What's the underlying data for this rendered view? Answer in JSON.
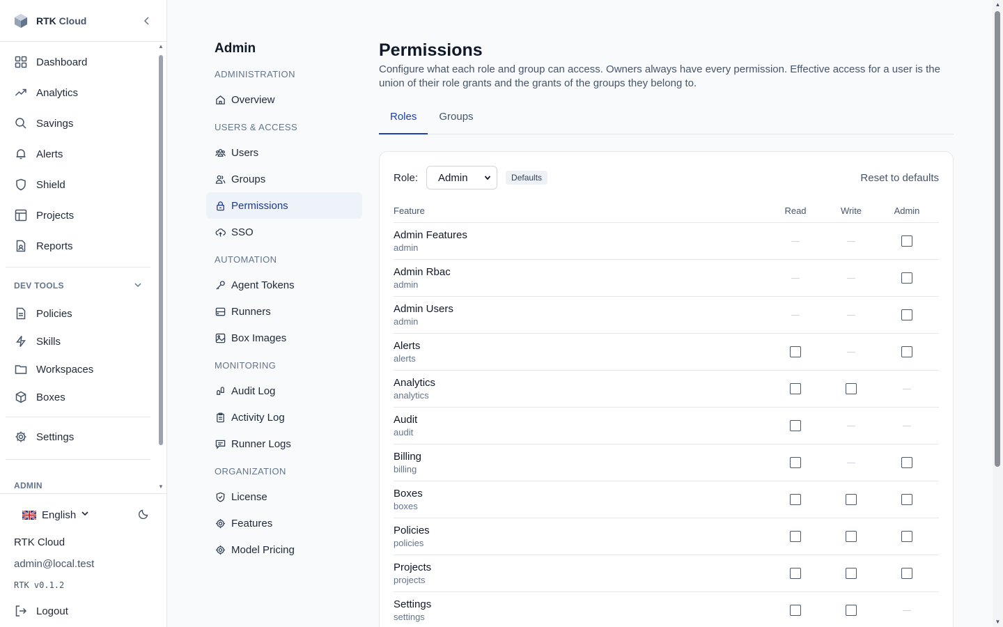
{
  "brand": {
    "name_part1": "RTK",
    "name_part2": "Cloud"
  },
  "sidebar": {
    "items": [
      {
        "label": "Dashboard",
        "icon": "dashboard-icon"
      },
      {
        "label": "Analytics",
        "icon": "trend-icon"
      },
      {
        "label": "Savings",
        "icon": "search-icon"
      },
      {
        "label": "Alerts",
        "icon": "bell-icon"
      },
      {
        "label": "Shield",
        "icon": "shield-icon"
      },
      {
        "label": "Projects",
        "icon": "table-icon"
      },
      {
        "label": "Reports",
        "icon": "report-icon"
      }
    ],
    "dev_tools_label": "DEV TOOLS",
    "dev_tools": [
      {
        "label": "Policies",
        "icon": "document-icon"
      },
      {
        "label": "Skills",
        "icon": "bolt-icon"
      },
      {
        "label": "Workspaces",
        "icon": "folder-icon"
      },
      {
        "label": "Boxes",
        "icon": "box-icon"
      }
    ],
    "settings_label": "Settings",
    "admin_label": "ADMIN"
  },
  "footer": {
    "language": "English",
    "org_name": "RTK Cloud",
    "email": "admin@local.test",
    "version": "RTK v0.1.2",
    "logout": "Logout"
  },
  "subnav": {
    "title": "Admin",
    "sections": {
      "administration": "ADMINISTRATION",
      "users_access": "USERS & ACCESS",
      "automation": "AUTOMATION",
      "monitoring": "MONITORING",
      "organization": "ORGANIZATION"
    },
    "overview": "Overview",
    "users": "Users",
    "groups": "Groups",
    "permissions": "Permissions",
    "sso": "SSO",
    "agent_tokens": "Agent Tokens",
    "runners": "Runners",
    "box_images": "Box Images",
    "audit_log": "Audit Log",
    "activity_log": "Activity Log",
    "runner_logs": "Runner Logs",
    "license": "License",
    "features": "Features",
    "model_pricing": "Model Pricing"
  },
  "main": {
    "title": "Permissions",
    "description": "Configure what each role and group can access. Owners always have every permission. Effective access for a user is the union of their role grants and the grants of the groups they belong to.",
    "tabs": [
      "Roles",
      "Groups"
    ],
    "role_label": "Role:",
    "role_value": "Admin",
    "badge": "Defaults",
    "reset": "Reset to defaults",
    "columns": {
      "feature": "Feature",
      "read": "Read",
      "write": "Write",
      "admin": "Admin"
    },
    "rows": [
      {
        "name": "Admin Features",
        "key": "admin",
        "read": "n/a",
        "write": "n/a",
        "admin": "off"
      },
      {
        "name": "Admin Rbac",
        "key": "admin",
        "read": "n/a",
        "write": "n/a",
        "admin": "off"
      },
      {
        "name": "Admin Users",
        "key": "admin",
        "read": "n/a",
        "write": "n/a",
        "admin": "off"
      },
      {
        "name": "Alerts",
        "key": "alerts",
        "read": "off",
        "write": "n/a",
        "admin": "off"
      },
      {
        "name": "Analytics",
        "key": "analytics",
        "read": "off",
        "write": "off",
        "admin": "n/a"
      },
      {
        "name": "Audit",
        "key": "audit",
        "read": "off",
        "write": "n/a",
        "admin": "n/a"
      },
      {
        "name": "Billing",
        "key": "billing",
        "read": "off",
        "write": "n/a",
        "admin": "off"
      },
      {
        "name": "Boxes",
        "key": "boxes",
        "read": "off",
        "write": "off",
        "admin": "off"
      },
      {
        "name": "Policies",
        "key": "policies",
        "read": "off",
        "write": "off",
        "admin": "off"
      },
      {
        "name": "Projects",
        "key": "projects",
        "read": "off",
        "write": "off",
        "admin": "off"
      },
      {
        "name": "Settings",
        "key": "settings",
        "read": "off",
        "write": "off",
        "admin": "n/a"
      }
    ]
  }
}
